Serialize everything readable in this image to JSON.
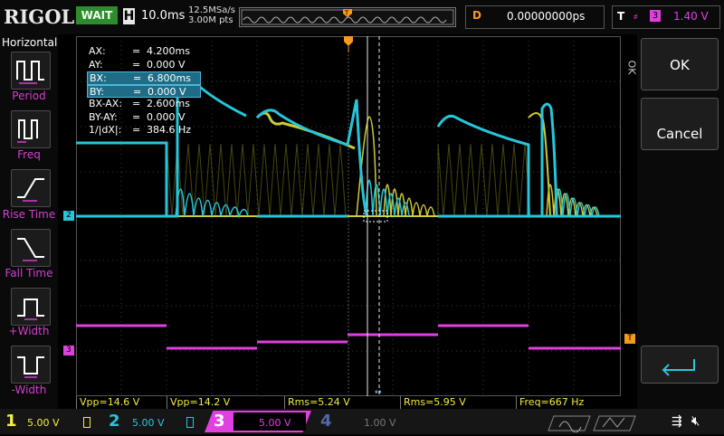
{
  "brand": "RIGOL",
  "run_state": "WAIT",
  "horizontal": {
    "label": "H",
    "timebase": "10.0ms",
    "sample_rate": "12.5MSa/s",
    "mem_depth": "3.00M pts"
  },
  "delay": {
    "label": "D",
    "value": "0.00000000ps"
  },
  "trigger": {
    "label": "T",
    "source": "3",
    "level": "1.40 V"
  },
  "left_menu": {
    "title": "Horizontal",
    "items": [
      {
        "label": "Period",
        "icon": "period-icon"
      },
      {
        "label": "Freq",
        "icon": "freq-icon"
      },
      {
        "label": "Rise Time",
        "icon": "rise-time-icon"
      },
      {
        "label": "Fall Time",
        "icon": "fall-time-icon"
      },
      {
        "label": "+Width",
        "icon": "positive-width-icon"
      },
      {
        "label": "-Width",
        "icon": "negative-width-icon"
      }
    ]
  },
  "cursor_table": [
    {
      "key": "AX:",
      "eq": "=",
      "value": "4.200ms",
      "highlight": false
    },
    {
      "key": "AY:",
      "eq": "=",
      "value": "0.000 V",
      "highlight": false
    },
    {
      "key": "BX:",
      "eq": "=",
      "value": "6.800ms",
      "highlight": true
    },
    {
      "key": "BY:",
      "eq": "=",
      "value": "0.000 V",
      "highlight": true
    },
    {
      "key": "BX-AX:",
      "eq": "=",
      "value": "2.600ms",
      "highlight": false
    },
    {
      "key": "BY-AY:",
      "eq": "=",
      "value": "0.000 V",
      "highlight": false
    },
    {
      "key": "1/|dX|:",
      "eq": "=",
      "value": "384.6 Hz",
      "highlight": false
    }
  ],
  "right_menu": {
    "side_label": "OK",
    "ok_label": "OK",
    "cancel_label": "Cancel"
  },
  "channel_markers": {
    "ch2": "2",
    "ch3": "3",
    "trig": "T"
  },
  "measurements": [
    "Vpp=14.6 V",
    "Vpp=14.2 V",
    "Rms=5.24 V",
    "Rms=5.95 V",
    "Freq=667 Hz"
  ],
  "channels": [
    {
      "num": "1",
      "scale": "5.00 V",
      "color": "#f2ee3a"
    },
    {
      "num": "2",
      "scale": "5.00 V",
      "color": "#26c6da"
    },
    {
      "num": "3",
      "scale": "5.00 V",
      "color": "#e040e0"
    },
    {
      "num": "4",
      "scale": "1.00 V",
      "color": "#4f6aa8"
    }
  ],
  "colors": {
    "ch1": "#f2ee3a",
    "ch2": "#26c6da",
    "ch3": "#e040e0",
    "accent": "#f59a1c"
  }
}
